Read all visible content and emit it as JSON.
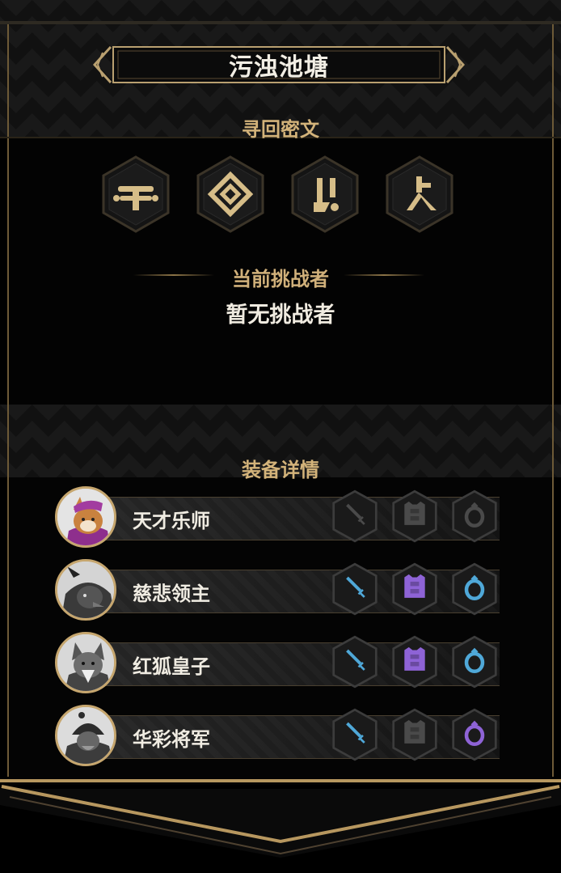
{
  "title": "污浊池塘",
  "runes": {
    "section_title": "寻回密文",
    "items": [
      {
        "icon": "rune-t-icon"
      },
      {
        "icon": "rune-diamond-icon"
      },
      {
        "icon": "rune-fork-icon"
      },
      {
        "icon": "rune-branch-icon"
      }
    ]
  },
  "challenger": {
    "label": "当前挑战者",
    "value": "暂无挑战者"
  },
  "equipment": {
    "section_title": "装备详情",
    "heroes": [
      {
        "name": "天才乐师",
        "portrait": "corgi-musician-portrait",
        "slots": [
          {
            "icon": "sword-icon",
            "color": "#4a4a4a",
            "active": false
          },
          {
            "icon": "armor-icon",
            "color": "#4a4a4a",
            "active": false
          },
          {
            "icon": "ring-icon",
            "color": "#4a4a4a",
            "active": false
          }
        ]
      },
      {
        "name": "慈悲领主",
        "portrait": "hooded-lord-portrait",
        "slots": [
          {
            "icon": "sword-icon",
            "color": "#4fa8d8",
            "active": true
          },
          {
            "icon": "armor-icon",
            "color": "#8e63d6",
            "active": true
          },
          {
            "icon": "ring-icon",
            "color": "#4fa8d8",
            "active": true
          }
        ]
      },
      {
        "name": "红狐皇子",
        "portrait": "fox-prince-portrait",
        "slots": [
          {
            "icon": "sword-icon",
            "color": "#4fa8d8",
            "active": true
          },
          {
            "icon": "armor-icon",
            "color": "#8e63d6",
            "active": true
          },
          {
            "icon": "ring-icon",
            "color": "#4fa8d8",
            "active": true
          }
        ]
      },
      {
        "name": "华彩将军",
        "portrait": "general-portrait",
        "slots": [
          {
            "icon": "sword-icon",
            "color": "#4fa8d8",
            "active": true
          },
          {
            "icon": "armor-icon",
            "color": "#4a4a4a",
            "active": false
          },
          {
            "icon": "ring-icon",
            "color": "#8e63d6",
            "active": true
          }
        ]
      }
    ]
  },
  "colors": {
    "gold": "#c6a66e",
    "blue": "#4fa8d8",
    "purple": "#8e63d6",
    "inactive": "#4a4a4a"
  }
}
